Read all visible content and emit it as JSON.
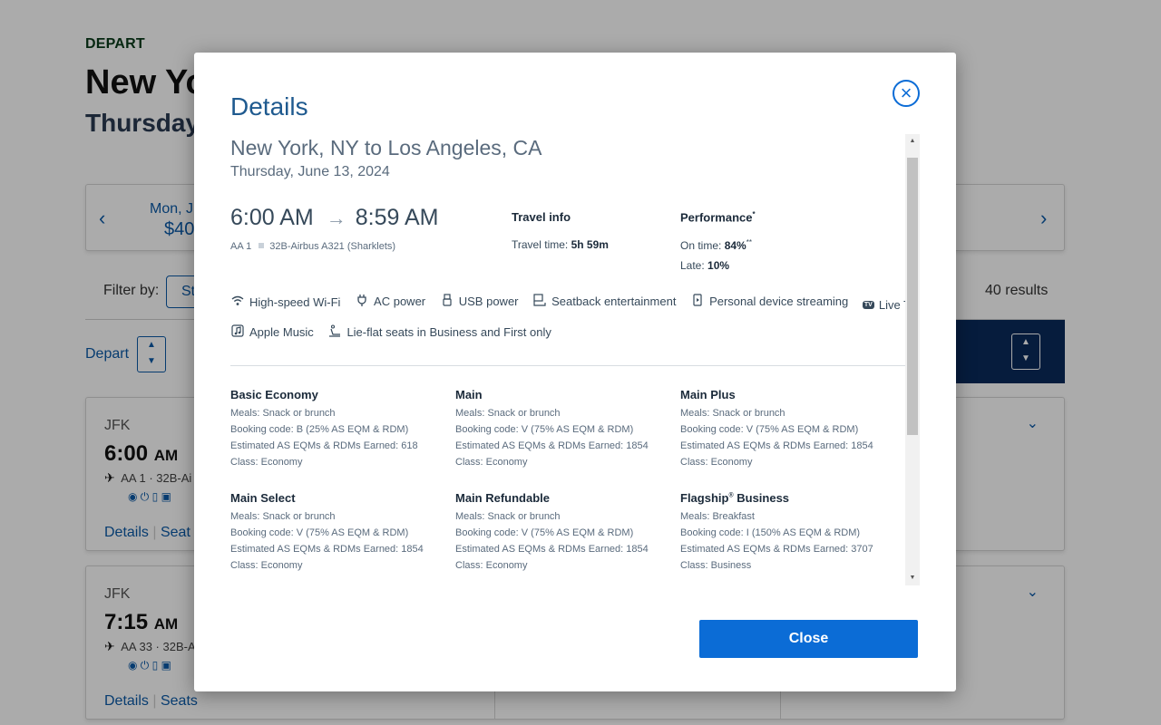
{
  "background": {
    "depart_label": "DEPART",
    "route_title": "New Yo",
    "date_title": "Thursday",
    "date_strip": {
      "prev_arrow": "‹",
      "next_arrow": "›",
      "day": "Mon, Ju",
      "price": "$40"
    },
    "filter_label": "Filter by:",
    "filter_button": "St",
    "results_count": "40 results",
    "depart_sort_label": "Depart",
    "flights": [
      {
        "airport": "JFK",
        "time": "6:00",
        "ampm": "AM",
        "flight": "AA 1 · 32B-Ai",
        "details_link": "Details",
        "seats_link": "Seat"
      },
      {
        "airport": "JFK",
        "time": "7:15",
        "ampm": "AM",
        "flight": "AA 33 · 32B-A",
        "details_link": "Details",
        "seats_link": "Seats"
      }
    ]
  },
  "modal": {
    "title": "Details",
    "route": "New York, NY to Los Angeles, CA",
    "date": "Thursday, June 13, 2024",
    "depart_time": "6:00 AM",
    "arrive_time": "8:59 AM",
    "flight_number": "AA 1",
    "aircraft": "32B-Airbus A321 (Sharklets)",
    "travel_info": {
      "heading": "Travel info",
      "time_label": "Travel time:",
      "time_value": "5h 59m"
    },
    "performance": {
      "heading": "Performance",
      "heading_mark": "*",
      "on_time_label": "On time:",
      "on_time_value": "84%",
      "on_time_mark": "**",
      "late_label": "Late:",
      "late_value": "10%"
    },
    "amenities_row1": [
      {
        "icon": "wifi-icon",
        "label": "High-speed Wi-Fi"
      },
      {
        "icon": "ac-power-icon",
        "label": "AC power"
      },
      {
        "icon": "usb-power-icon",
        "label": "USB power"
      },
      {
        "icon": "seatback-entertainment-icon",
        "label": "Seatback entertainment"
      },
      {
        "icon": "device-streaming-icon",
        "label": "Personal device streaming"
      },
      {
        "icon": "live-tv-icon",
        "label": "Live TV"
      }
    ],
    "amenities_row2": [
      {
        "icon": "apple-music-icon",
        "label": "Apple Music"
      },
      {
        "icon": "lie-flat-seat-icon",
        "label": "Lie-flat seats in Business and First only"
      }
    ],
    "fares": [
      {
        "name": "Basic Economy",
        "meals": "Meals: Snack or brunch",
        "booking": "Booking code: B (25% AS EQM & RDM)",
        "earned": "Estimated AS EQMs & RDMs Earned: 618",
        "class": "Class: Economy"
      },
      {
        "name": "Main",
        "meals": "Meals: Snack or brunch",
        "booking": "Booking code: V (75% AS EQM & RDM)",
        "earned": "Estimated AS EQMs & RDMs Earned: 1854",
        "class": "Class: Economy"
      },
      {
        "name": "Main Plus",
        "meals": "Meals: Snack or brunch",
        "booking": "Booking code: V (75% AS EQM & RDM)",
        "earned": "Estimated AS EQMs & RDMs Earned: 1854",
        "class": "Class: Economy"
      },
      {
        "name": "Main Select",
        "meals": "Meals: Snack or brunch",
        "booking": "Booking code: V (75% AS EQM & RDM)",
        "earned": "Estimated AS EQMs & RDMs Earned: 1854",
        "class": "Class: Economy"
      },
      {
        "name": "Main Refundable",
        "meals": "Meals: Snack or brunch",
        "booking": "Booking code: V (75% AS EQM & RDM)",
        "earned": "Estimated AS EQMs & RDMs Earned: 1854",
        "class": "Class: Economy"
      },
      {
        "name": "Flagship",
        "name_mark": "®",
        "name_suffix": " Business",
        "meals": "Meals: Breakfast",
        "booking": "Booking code: I (150% AS EQM & RDM)",
        "earned": "Estimated AS EQMs & RDMs Earned: 3707",
        "class": "Class: Business"
      }
    ],
    "close_button": "Close",
    "colors": {
      "accent": "#0b6cd6",
      "title": "#1f5a8f",
      "text": "#36495a"
    }
  }
}
